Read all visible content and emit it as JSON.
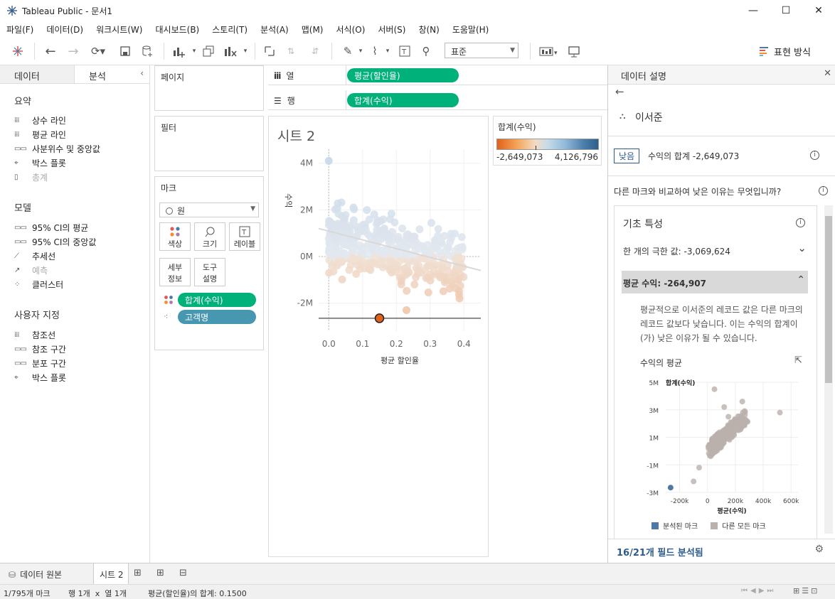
{
  "window": {
    "title": "Tableau Public - 문서1"
  },
  "menu": [
    "파일(F)",
    "데이터(D)",
    "워크시트(W)",
    "대시보드(B)",
    "스토리(T)",
    "분석(A)",
    "맵(M)",
    "서식(O)",
    "서버(S)",
    "창(N)",
    "도움말(H)"
  ],
  "toolbar": {
    "fit_value": "표준",
    "show_me": "표현 방식"
  },
  "left_pane": {
    "tab_data": "데이터",
    "tab_analytics": "분석",
    "summary_title": "요약",
    "summary_items": [
      "상수 라인",
      "평균 라인",
      "사분위수 및 중앙값",
      "박스 플롯",
      "총계"
    ],
    "model_title": "모델",
    "model_items": [
      "95% CI의 평균",
      "95% CI의 중앙값",
      "추세선",
      "예측",
      "클러스터"
    ],
    "custom_title": "사용자 지정",
    "custom_items": [
      "참조선",
      "참조 구간",
      "분포 구간",
      "박스 플롯"
    ]
  },
  "cards": {
    "pages": "페이지",
    "filters": "필터",
    "marks": "마크",
    "mark_type": "원",
    "mark_buttons": {
      "color": "색상",
      "size": "크기",
      "label": "레이블",
      "detail": "세부\n정보",
      "tooltip": "도구\n설명"
    },
    "mark_pills": [
      "합계(수익)",
      "고객명"
    ]
  },
  "shelves": {
    "columns_label": "열",
    "columns_pill": "평균(할인율)",
    "rows_label": "행",
    "rows_pill": "합계(수익)"
  },
  "viz": {
    "sheet_title": "시트 2",
    "x_axis_title": "평균 할인율",
    "y_axis_title": "수익"
  },
  "legend": {
    "title": "합계(수익)",
    "min": "-2,649,073",
    "max": "4,126,796"
  },
  "explain": {
    "header": "데이터 설명",
    "mark_name": "이서준",
    "low_badge": "낮음",
    "sum_line": "수익의 합계  -2,649,073",
    "question": "다른 마크와 비교하여 낮은 이유는 무엇입니까?",
    "basic_title": "기초 특성",
    "extreme_line": "한 개의 극한 값: -3,069,624",
    "avg_line": "평균 수익: -264,907",
    "avg_desc": "평균적으로 이서준의 레코드 값은 다른 마크의 레코드 값보다 낮습니다. 이는 수익의 합계이(가) 낮은 이유가 될 수 있습니다.",
    "mini_title": "수익의 평균",
    "mini_legend_selected": "분석된 마크",
    "mini_legend_others": "다른 모든 마크",
    "footer": "16/21개 필드 분석됨"
  },
  "mini_chart": {
    "type": "scatter",
    "ylabel": "합계(수익)",
    "xlabel": "평균(수익)",
    "x_ticks": [
      "-200k",
      "0",
      "200k",
      "400k",
      "600k"
    ],
    "y_ticks": [
      "5M",
      "3M",
      "1M",
      "-1M",
      "-3M"
    ],
    "selected_point": {
      "x": -264907,
      "y": -2649073
    },
    "colors": {
      "selected": "#4e79a7",
      "others": "#bab0ac"
    }
  },
  "chart_data": {
    "type": "scatter",
    "x_ticks": [
      "0.0",
      "0.1",
      "0.2",
      "0.3",
      "0.4"
    ],
    "y_ticks": [
      "4M",
      "2M",
      "0M",
      "-2M"
    ],
    "xlim": [
      -0.03,
      0.45
    ],
    "ylim": [
      -3.2,
      4.6
    ],
    "selected_point": {
      "x": 0.15,
      "y": -2.649
    },
    "trend_line": [
      [
        -0.03,
        1.2
      ],
      [
        0.45,
        -0.6
      ]
    ],
    "reference_line_y": 0,
    "reference_line_x": 0
  },
  "tabs": {
    "data_source": "데이터 원본",
    "sheet": "시트 2"
  },
  "status": {
    "marks": "1/795개 마크",
    "rows_cols": "행 1개  x  열 1개",
    "sum": "평균(할인율)의 합계: 0.1500"
  },
  "colors": {
    "green_pill": "#00b17a",
    "blue_pill": "#4897b1",
    "selected_badge": "#2e5c8a",
    "diverging_low": "#e0621b",
    "diverging_high": "#2d5f8c"
  }
}
